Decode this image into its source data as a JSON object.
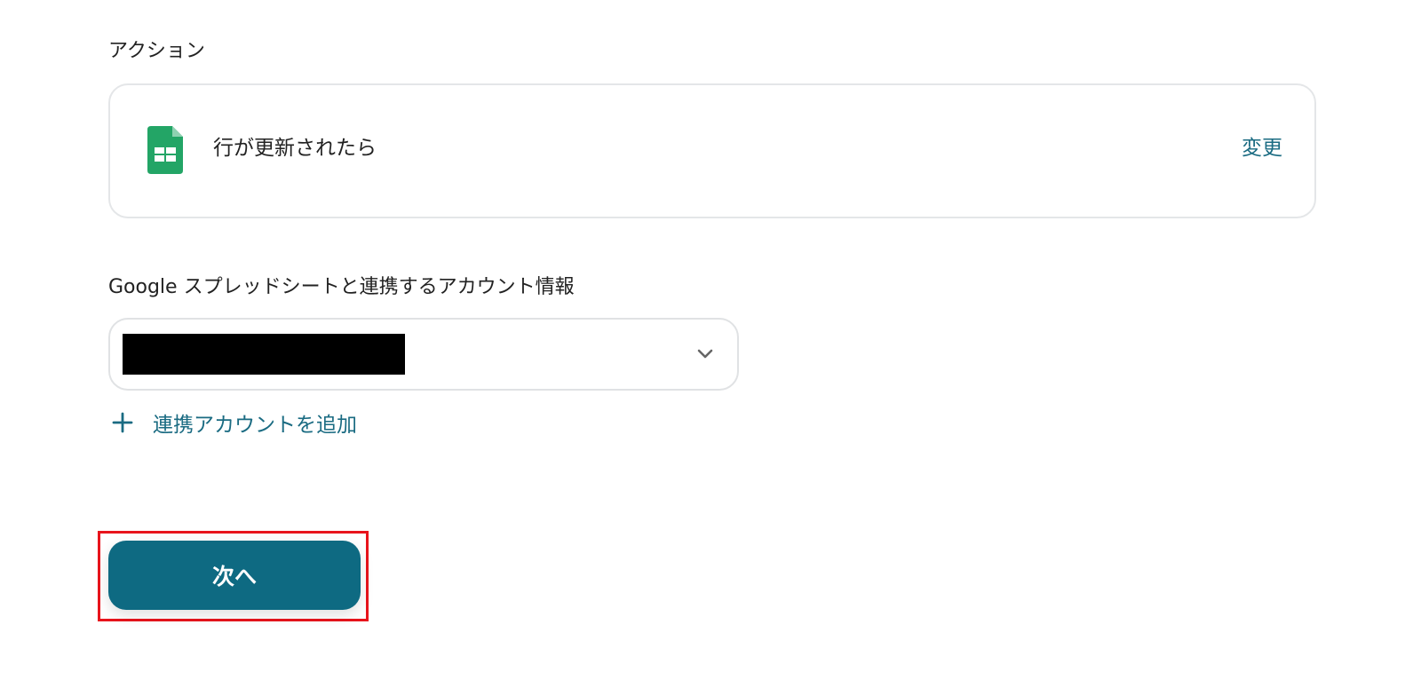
{
  "action_section": {
    "label": "アクション",
    "card": {
      "app_icon": "google-sheets-icon",
      "action_name": "行が更新されたら",
      "change_label": "変更"
    }
  },
  "account_section": {
    "label": "Google スプレッドシートと連携するアカウント情報",
    "select": {
      "value": "",
      "value_redacted": true
    },
    "add_account_label": "連携アカウントを追加"
  },
  "next_button": {
    "label": "次へ",
    "highlighted": true
  },
  "colors": {
    "accent": "#1a6b82",
    "button": "#0e6a82",
    "highlight": "#e8141c",
    "sheets_green": "#23a566"
  }
}
